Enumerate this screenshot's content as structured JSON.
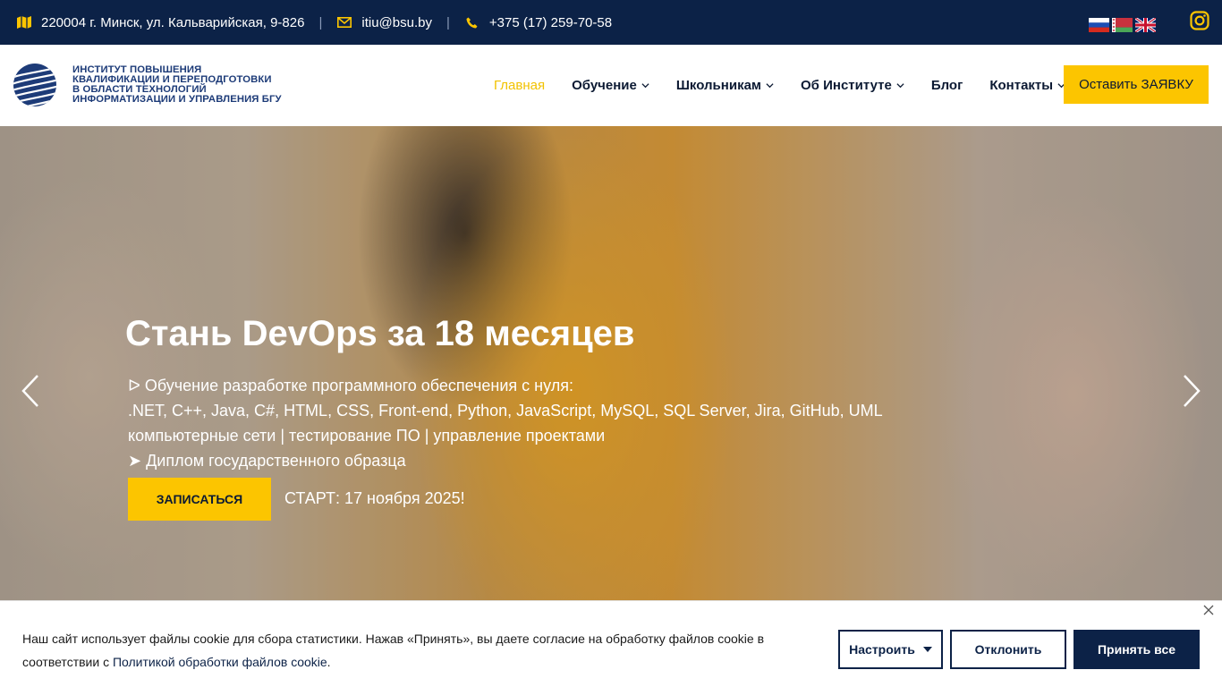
{
  "topbar": {
    "address": "220004 г. Минск, ул. Кальварийская, 9-826",
    "email": "itiu@bsu.by",
    "phone": "+375 (17) 259-70-58",
    "separator": "|",
    "languages": [
      "ru",
      "be",
      "en"
    ]
  },
  "header": {
    "logo_lines": [
      "ИНСТИТУТ ПОВЫШЕНИЯ",
      "КВАЛИФИКАЦИИ И ПЕРЕПОДГОТОВКИ",
      "В ОБЛАСТИ ТЕХНОЛОГИЙ",
      "ИНФОРМАТИЗАЦИИ И УПРАВЛЕНИЯ БГУ"
    ],
    "nav": [
      {
        "label": "Главная",
        "active": true,
        "dropdown": false
      },
      {
        "label": "Обучение",
        "active": false,
        "dropdown": true
      },
      {
        "label": "Школьникам",
        "active": false,
        "dropdown": true
      },
      {
        "label": "Об Институте",
        "active": false,
        "dropdown": true
      },
      {
        "label": "Блог",
        "active": false,
        "dropdown": false
      },
      {
        "label": "Контакты",
        "active": false,
        "dropdown": true
      }
    ],
    "cta_label": "Оставить ЗАЯВКУ"
  },
  "hero": {
    "title": "Стань DevOps за 18 месяцев",
    "lines": [
      "ᐅ Обучение разработке программного обеспечения с нуля:",
      ".NET, C++, Java, C#, HTML, CSS, Front-end, Python, JavaScript, MySQL, SQL Server, Jira, GitHub, UML",
      "компьютерные сети | тестирование ПО | управление проектами",
      "➤ Диплом государственного образца"
    ],
    "button_label": "ЗАПИСАТЬСЯ",
    "start_text": "СТАРТ: 17 ноября 2025!"
  },
  "cookie": {
    "text_before": "Наш сайт использует файлы cookie для сбора статистики. Нажав «Принять», вы даете согласие на обработку файлов cookie в соответствии с ",
    "link_text": "Политикой обработки файлов cookie",
    "text_after": ".",
    "settings_label": "Настроить",
    "reject_label": "Отклонить",
    "accept_label": "Принять все"
  },
  "colors": {
    "navy": "#0c2247",
    "accent": "#fcc500",
    "active_nav": "#f2c200"
  }
}
